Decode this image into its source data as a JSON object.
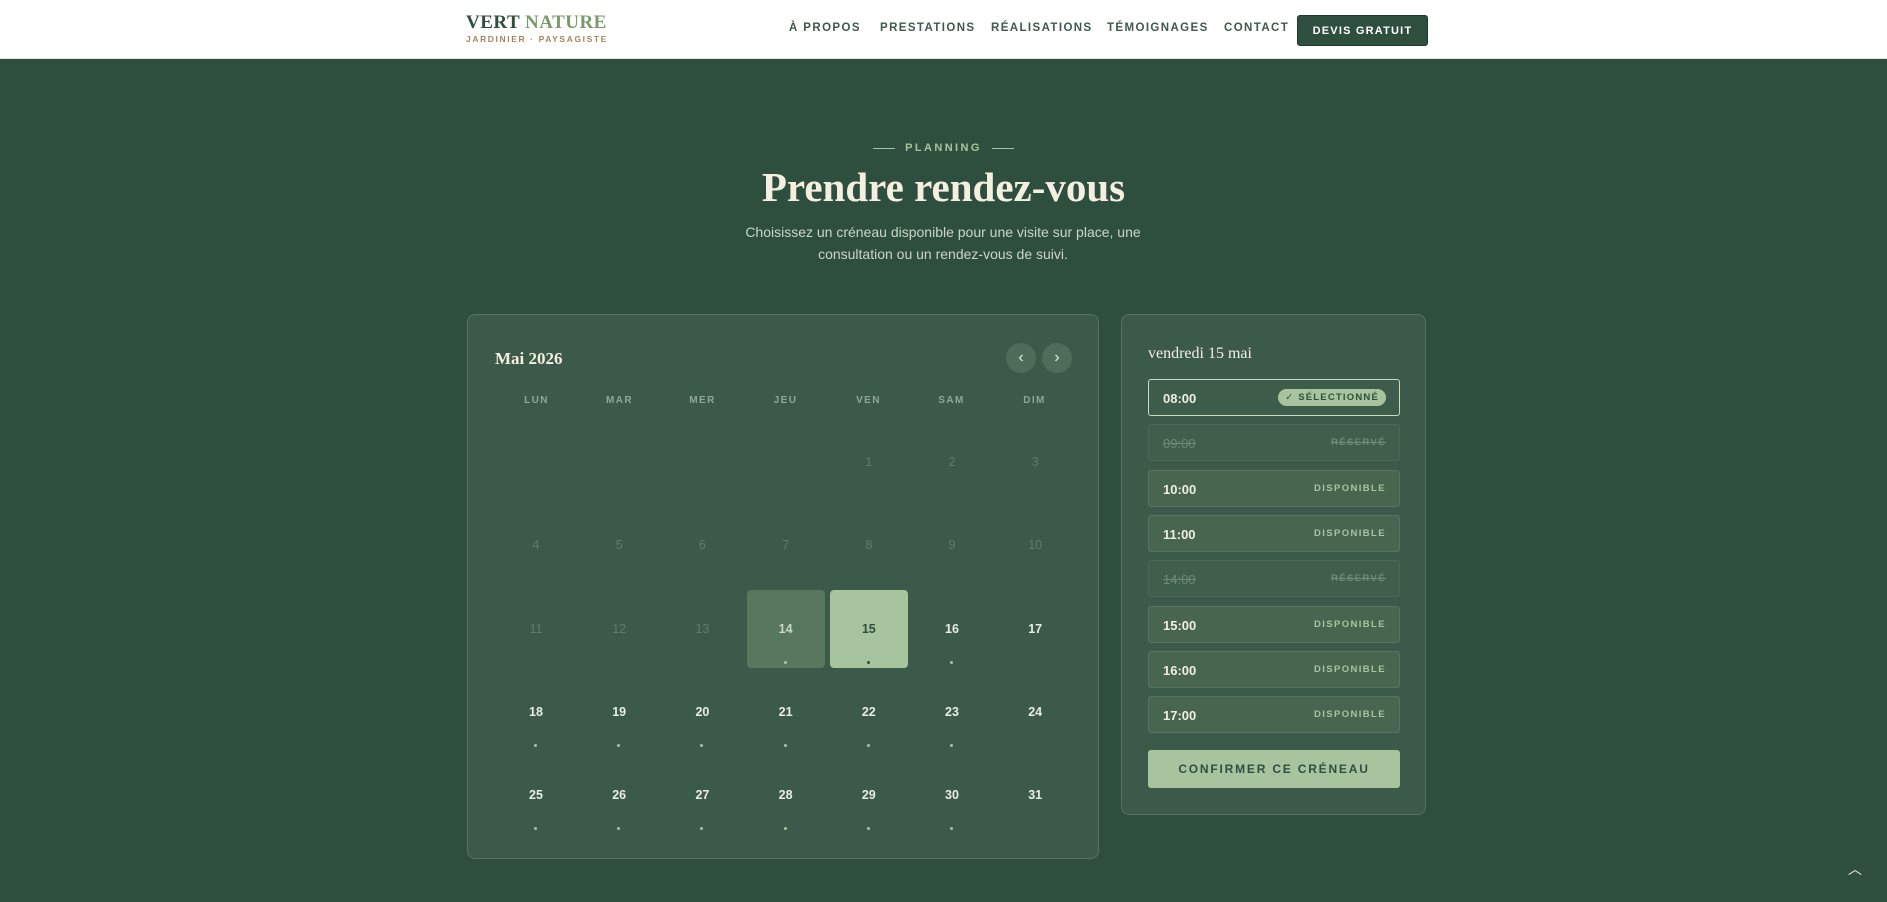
{
  "header": {
    "brand_word1": "VERT",
    "brand_word2": "NATURE",
    "brand_tagline": "JARDINIER · PAYSAGISTE",
    "nav": [
      "À PROPOS",
      "PRESTATIONS",
      "RÉALISATIONS",
      "TÉMOIGNAGES",
      "CONTACT"
    ],
    "cta": "DEVIS GRATUIT"
  },
  "section": {
    "eyebrow": "PLANNING",
    "title": "Prendre rendez-vous",
    "subtitle": "Choisissez un créneau disponible pour une visite sur place, une consultation ou un rendez-vous de suivi."
  },
  "calendar": {
    "month": "Mai 2026",
    "prev_icon": "‹",
    "next_icon": "›",
    "weekdays": [
      "LUN",
      "MAR",
      "MER",
      "JEU",
      "VEN",
      "SAM",
      "DIM"
    ],
    "days": [
      {
        "n": "1",
        "s": "past"
      },
      {
        "n": "2",
        "s": "past"
      },
      {
        "n": "3",
        "s": "past"
      },
      {
        "n": "4",
        "s": "past"
      },
      {
        "n": "5",
        "s": "past"
      },
      {
        "n": "6",
        "s": "past"
      },
      {
        "n": "7",
        "s": "past"
      },
      {
        "n": "8",
        "s": "past"
      },
      {
        "n": "9",
        "s": "past"
      },
      {
        "n": "10",
        "s": "past"
      },
      {
        "n": "11",
        "s": "past"
      },
      {
        "n": "12",
        "s": "past"
      },
      {
        "n": "13",
        "s": "past"
      },
      {
        "n": "14",
        "s": "today"
      },
      {
        "n": "15",
        "s": "sel"
      },
      {
        "n": "16",
        "s": "avail"
      },
      {
        "n": "17",
        "s": "nodot"
      },
      {
        "n": "18",
        "s": "avail"
      },
      {
        "n": "19",
        "s": "avail"
      },
      {
        "n": "20",
        "s": "avail"
      },
      {
        "n": "21",
        "s": "avail"
      },
      {
        "n": "22",
        "s": "avail"
      },
      {
        "n": "23",
        "s": "avail"
      },
      {
        "n": "24",
        "s": "nodot"
      },
      {
        "n": "25",
        "s": "avail"
      },
      {
        "n": "26",
        "s": "avail"
      },
      {
        "n": "27",
        "s": "avail"
      },
      {
        "n": "28",
        "s": "avail"
      },
      {
        "n": "29",
        "s": "avail"
      },
      {
        "n": "30",
        "s": "avail"
      },
      {
        "n": "31",
        "s": "nodot"
      }
    ]
  },
  "slots": {
    "date": "vendredi 15 mai",
    "items": [
      {
        "time": "08:00",
        "status": "✓ SÉLECTIONNÉ",
        "state": "selected"
      },
      {
        "time": "09:00",
        "status": "RÉSERVÉ",
        "state": "reserved"
      },
      {
        "time": "10:00",
        "status": "DISPONIBLE",
        "state": "available"
      },
      {
        "time": "11:00",
        "status": "DISPONIBLE",
        "state": "available"
      },
      {
        "time": "14:00",
        "status": "RÉSERVÉ",
        "state": "reserved"
      },
      {
        "time": "15:00",
        "status": "DISPONIBLE",
        "state": "available"
      },
      {
        "time": "16:00",
        "status": "DISPONIBLE",
        "state": "available"
      },
      {
        "time": "17:00",
        "status": "DISPONIBLE",
        "state": "available"
      }
    ],
    "confirm": "CONFIRMER CE CRÉNEAU"
  },
  "scroll_top_icon": "︿",
  "colors": {
    "background": "#2f4f3e",
    "card": "#3b5a49",
    "accent": "#a8c49f",
    "brand_green": "#2f4f3e",
    "brand_tan": "#a8845a"
  }
}
